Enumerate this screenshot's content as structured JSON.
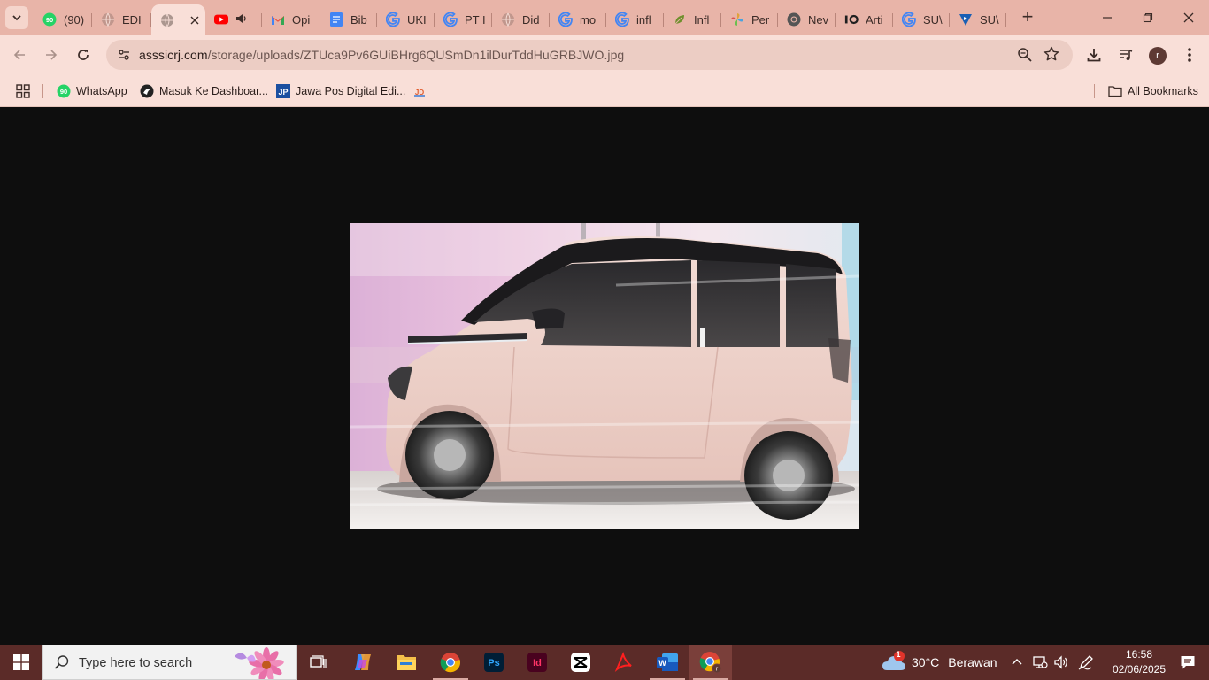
{
  "tabs": [
    {
      "title": "(90)",
      "icon": "whatsapp-icon",
      "color": "#25d366",
      "badge": "90",
      "active": false,
      "width": 66
    },
    {
      "title": "EDI",
      "icon": "globe-icon",
      "color": "#b08a82",
      "active": false,
      "width": 67
    },
    {
      "title": "",
      "icon": "globe-icon",
      "color": "#8a7671",
      "active": true,
      "width": 61
    },
    {
      "title": "",
      "icon": "youtube-icon",
      "color": "#ff0000",
      "active": false,
      "width": 64,
      "audio": true
    },
    {
      "title": "Opi",
      "icon": "gmail-icon",
      "color": "#ea4335",
      "active": false,
      "width": 66
    },
    {
      "title": "Bib",
      "icon": "docs-icon",
      "color": "#4285f4",
      "active": false,
      "width": 64
    },
    {
      "title": "UKI",
      "icon": "google-icon",
      "color": "#4285f4",
      "active": false,
      "width": 65
    },
    {
      "title": "PT I",
      "icon": "google-icon",
      "color": "#4285f4",
      "active": false,
      "width": 65
    },
    {
      "title": "Did",
      "icon": "globe-icon",
      "color": "#b08a82",
      "active": false,
      "width": 65
    },
    {
      "title": "mo",
      "icon": "google-icon",
      "color": "#4285f4",
      "active": false,
      "width": 64
    },
    {
      "title": "infl",
      "icon": "google-icon",
      "color": "#4285f4",
      "active": false,
      "width": 65
    },
    {
      "title": "Infl",
      "icon": "leaf-icon",
      "color": "#6e8f2c",
      "active": false,
      "width": 65
    },
    {
      "title": "Per",
      "icon": "pinwheel-icon",
      "color": "#e0a23a",
      "active": false,
      "width": 64
    },
    {
      "title": "Nev",
      "icon": "chrome-gray-icon",
      "color": "#555555",
      "active": false,
      "width": 65
    },
    {
      "title": "Arti",
      "icon": "io-icon",
      "color": "#1f1f1f",
      "active": false,
      "width": 65
    },
    {
      "title": "SU\\",
      "icon": "google-icon",
      "color": "#4285f4",
      "active": false,
      "width": 64
    },
    {
      "title": "SU\\",
      "icon": "play-shield-icon",
      "color": "#1a5fb4",
      "active": false,
      "width": 64
    }
  ],
  "toolbar": {
    "url_host": "asssicrj.com",
    "url_path": "/storage/uploads/ZTUca9Pv6GUiBHrg6QUSmDn1ilDurTddHuGRBJWO.jpg",
    "profile_initial": "r"
  },
  "bookmarks": {
    "items": [
      {
        "label": "WhatsApp",
        "icon": "whatsapp-icon",
        "color": "#25d366"
      },
      {
        "label": "Masuk Ke Dashboar...",
        "icon": "circle-logo-icon",
        "color": "#222222"
      },
      {
        "label": "Jawa Pos Digital Edi...",
        "icon": "jp-icon",
        "color": "#1b4fa0"
      },
      {
        "label": "",
        "icon": "jdih-icon",
        "color": "#e05a2b"
      }
    ],
    "all_label": "All Bookmarks"
  },
  "photo": {
    "subject": "pink-minivan",
    "colors": {
      "body": "#efd3cc",
      "roof": "#1b1a1c",
      "bg": "#e9bcd8"
    }
  },
  "taskbar": {
    "search_placeholder": "Type here to search",
    "weather_temp": "30°C",
    "weather_text": "Berawan",
    "weather_badge": "1",
    "time": "16:58",
    "date": "02/06/2025"
  }
}
